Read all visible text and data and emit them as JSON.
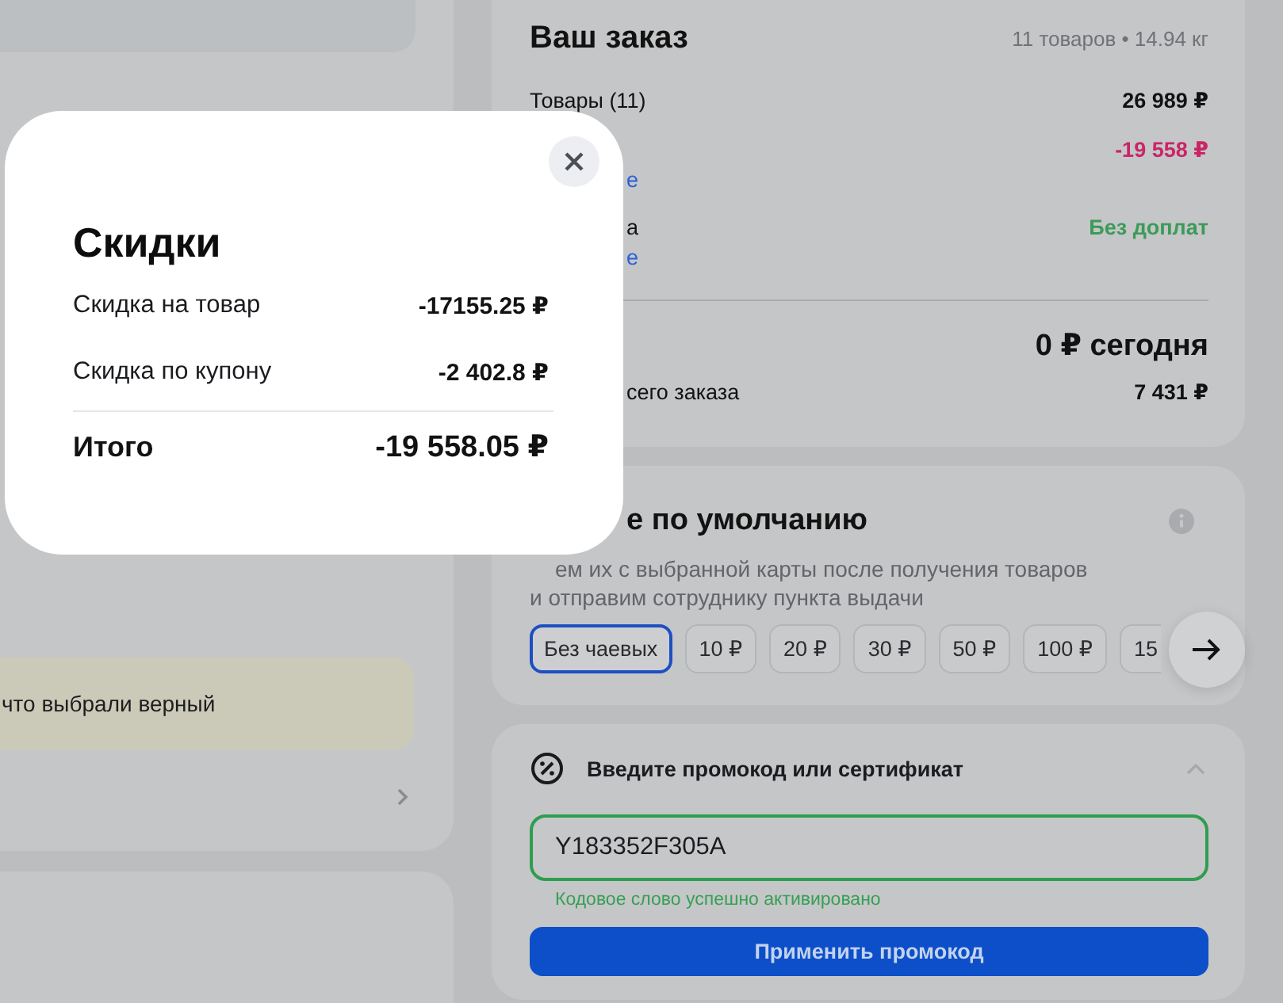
{
  "left_column": {
    "notice": "что выбрали верный"
  },
  "order": {
    "title": "Ваш заказ",
    "summary": "11 товаров • 14.94 кг",
    "rows": [
      {
        "label": "Товары (11)",
        "value": "26 989 ₽",
        "color": "#121212",
        "covered": false
      },
      {
        "value": "-19 558 ₽",
        "color": "#c92567",
        "link": "е",
        "covered": true
      },
      {
        "label": "а",
        "value": "Без доплат",
        "color": "#3b9b58",
        "link": "е",
        "covered": true
      }
    ],
    "total": "0 ₽ сегодня",
    "footnote": {
      "label": "сего заказа",
      "value": "7 431 ₽",
      "covered": true
    }
  },
  "tips": {
    "title": {
      "text": "е по умолчанию",
      "covered": true
    },
    "description": {
      "lines": [
        "ем их с выбранной карты после получения товаров",
        "и отправим сотруднику пункта выдачи"
      ],
      "covered": true
    },
    "options": [
      {
        "label": "Без чаевых",
        "selected": true
      },
      {
        "label": "10 ₽",
        "selected": false
      },
      {
        "label": "20 ₽",
        "selected": false
      },
      {
        "label": "30 ₽",
        "selected": false
      },
      {
        "label": "50 ₽",
        "selected": false
      },
      {
        "label": "100 ₽",
        "selected": false
      },
      {
        "label": "15",
        "selected": false
      }
    ]
  },
  "promo": {
    "title": "Введите промокод или сертификат",
    "expanded": true,
    "code": "Y183352F305A",
    "valid": true,
    "status": "Кодовое слово успешно активировано",
    "button": "Применить промокод"
  },
  "discount_popup": {
    "title": "Скидки",
    "rows": [
      {
        "label": "Скидка на товар",
        "value": "-17155.25 ₽"
      },
      {
        "label": "Скидка по купону",
        "value": "-2 402.8 ₽"
      }
    ],
    "total": {
      "label": "Итого",
      "value": "-19 558.05 ₽"
    }
  }
}
